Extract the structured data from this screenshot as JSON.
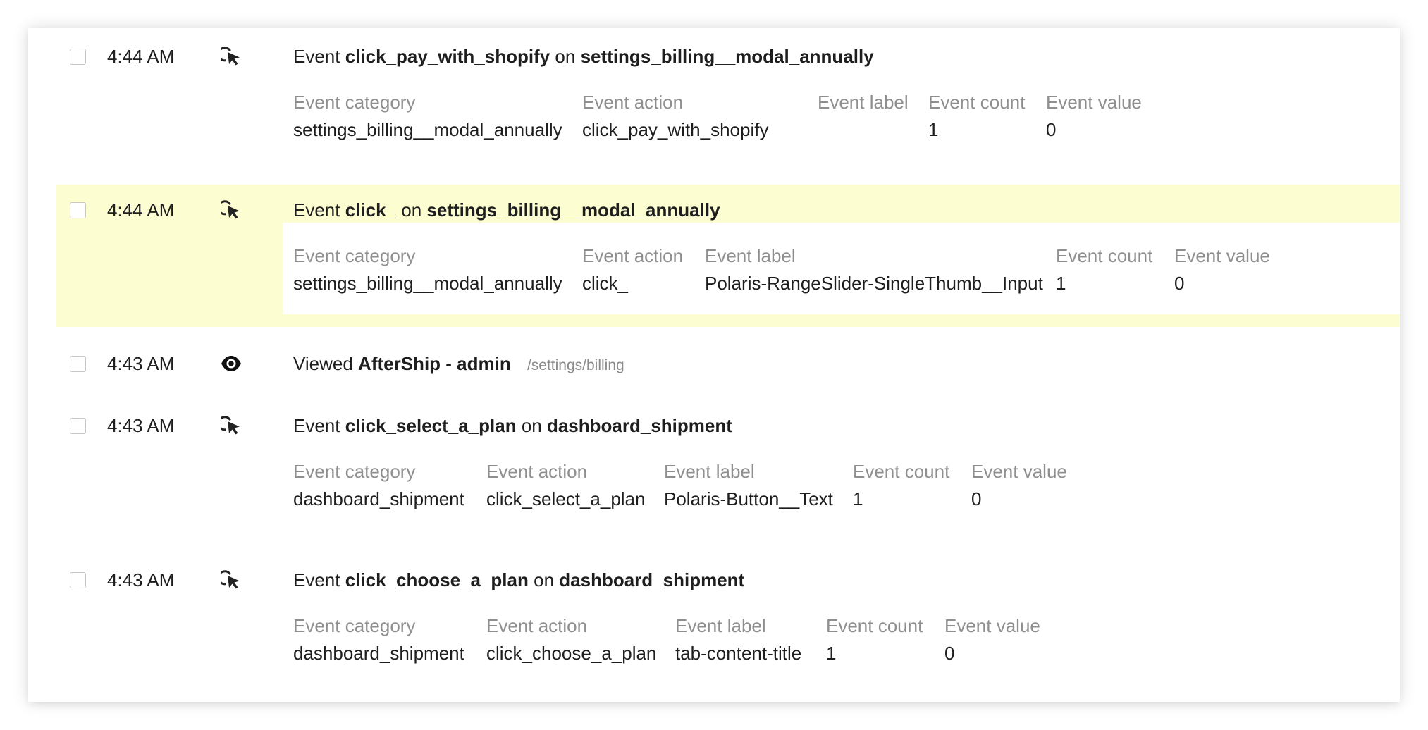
{
  "field_labels": {
    "category": "Event category",
    "action": "Event action",
    "label": "Event label",
    "count": "Event count",
    "value": "Event value"
  },
  "word_event": "Event",
  "word_on": "on",
  "word_viewed": "Viewed",
  "events": [
    {
      "time": "4:44 AM",
      "icon": "cursor-click-icon",
      "action": "click_pay_with_shopify",
      "target": "settings_billing__modal_annually",
      "category": "settings_billing__modal_annually",
      "label": "",
      "count": "1",
      "value": "0",
      "highlighted": false
    },
    {
      "time": "4:44 AM",
      "icon": "cursor-click-icon",
      "action": "click_",
      "target": "settings_billing__modal_annually",
      "category": "settings_billing__modal_annually",
      "label": "Polaris-RangeSlider-SingleThumb__Input",
      "count": "1",
      "value": "0",
      "highlighted": true,
      "highlight_color": "#fdfdd2"
    },
    {
      "time": "4:43 AM",
      "icon": "eye-icon",
      "page": "AfterShip - admin",
      "path": "/settings/billing"
    },
    {
      "time": "4:43 AM",
      "icon": "cursor-click-icon",
      "action": "click_select_a_plan",
      "target": "dashboard_shipment",
      "category": "dashboard_shipment",
      "label": "Polaris-Button__Text",
      "count": "1",
      "value": "0",
      "highlighted": false
    },
    {
      "time": "4:43 AM",
      "icon": "cursor-click-icon",
      "action": "click_choose_a_plan",
      "target": "dashboard_shipment",
      "category": "dashboard_shipment",
      "label": "tab-content-title",
      "count": "1",
      "value": "0",
      "highlighted": false
    }
  ]
}
